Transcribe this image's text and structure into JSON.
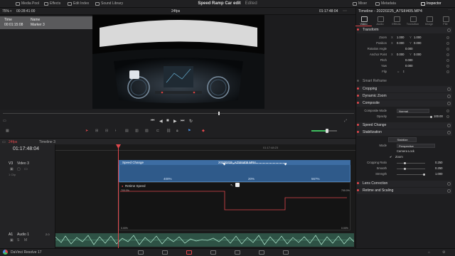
{
  "topbar": {
    "media_pool": "Media Pool",
    "effects": "Effects",
    "edit_index": "Edit Index",
    "sound_library": "Sound Library",
    "project_title": "Speed Ramp Car edit",
    "edited": "Edited",
    "mixer": "Mixer",
    "metadata": "Metadata",
    "inspector": "Inspector"
  },
  "viewer_bar": {
    "zoom": "75%",
    "timecode_left": "00:28:41:00",
    "fps": "24fps",
    "timecode_right": "01:17:48:04"
  },
  "marker_panel": {
    "time_header": "Time",
    "name_header": "Name",
    "time_value": "00:01:15:08",
    "name_value": "Marker 3"
  },
  "inspector": {
    "clip_name": "Timeline - 20220225_A7SIII405.MP4",
    "tabs": [
      "Video",
      "Audio",
      "Effects",
      "Transition",
      "Image",
      "File"
    ],
    "sections": {
      "transform": "Transform",
      "smart_reframe": "Smart Reframe",
      "cropping": "Cropping",
      "dynamic_zoom": "Dynamic Zoom",
      "composite": "Composite",
      "speed_change": "Speed Change",
      "stabilization": "Stabilization",
      "lens_correction": "Lens Correction",
      "retime_scaling": "Retime and Scaling"
    },
    "transform_props": {
      "zoom": "Zoom",
      "zoom_x_label": "X",
      "zoom_x": "1.000",
      "zoom_y_label": "Y",
      "zoom_y": "1.000",
      "position": "Position",
      "position_x_label": "X",
      "position_x": "0.000",
      "position_y_label": "Y",
      "position_y": "0.000",
      "rotation": "Rotation Angle",
      "rotation_val": "0.000",
      "anchor": "Anchor Point",
      "anchor_x_label": "X",
      "anchor_x": "0.000",
      "anchor_y_label": "Y",
      "anchor_y": "0.000",
      "pitch": "Pitch",
      "pitch_val": "0.000",
      "yaw": "Yaw",
      "yaw_val": "0.000",
      "flip": "Flip"
    },
    "composite_props": {
      "mode_label": "Composite Mode",
      "mode_value": "Normal",
      "opacity_label": "Opacity",
      "opacity_value": "100.00"
    },
    "stabilization_props": {
      "stabilize_btn": "Stabilize",
      "mode_label": "Mode",
      "mode_value": "Perspective",
      "camera_lock": "Camera Lock",
      "zoom": "Zoom",
      "crop_ratio_label": "Cropping Ratio",
      "crop_ratio_value": "0.250",
      "smooth_label": "Smooth",
      "smooth_value": "0.250",
      "strength_label": "Strength",
      "strength_value": "1.000"
    }
  },
  "timeline": {
    "fps_tab": "24fps",
    "timeline_name": "Timeline 3",
    "timecode": "01:17:48:04",
    "ruler_mark": "01:17:48:23",
    "video_track_id": "V3",
    "video_track_name": "Video 3",
    "video_track_clips": "1 Clip",
    "audio_track_id": "A1",
    "audio_track_name": "Audio 1",
    "audio_track_level": "2.0",
    "clip_label": "Speed Change",
    "clip_file": "20220225_A7SIII405.MP4",
    "speed_segments": [
      "400%",
      "20%",
      "567%"
    ],
    "retime_label": "Retime Speed",
    "retime_top_left": "700.0%",
    "retime_top_right": "700.0%",
    "retime_bot_left": "0.00%",
    "retime_bot_right": "0.00%"
  },
  "bottom": {
    "app_name": "DaVinci Resolve 17"
  },
  "colors": {
    "accent": "#e0474c",
    "clip_blue": "#3d6da3",
    "audio_green": "#2e5245"
  }
}
